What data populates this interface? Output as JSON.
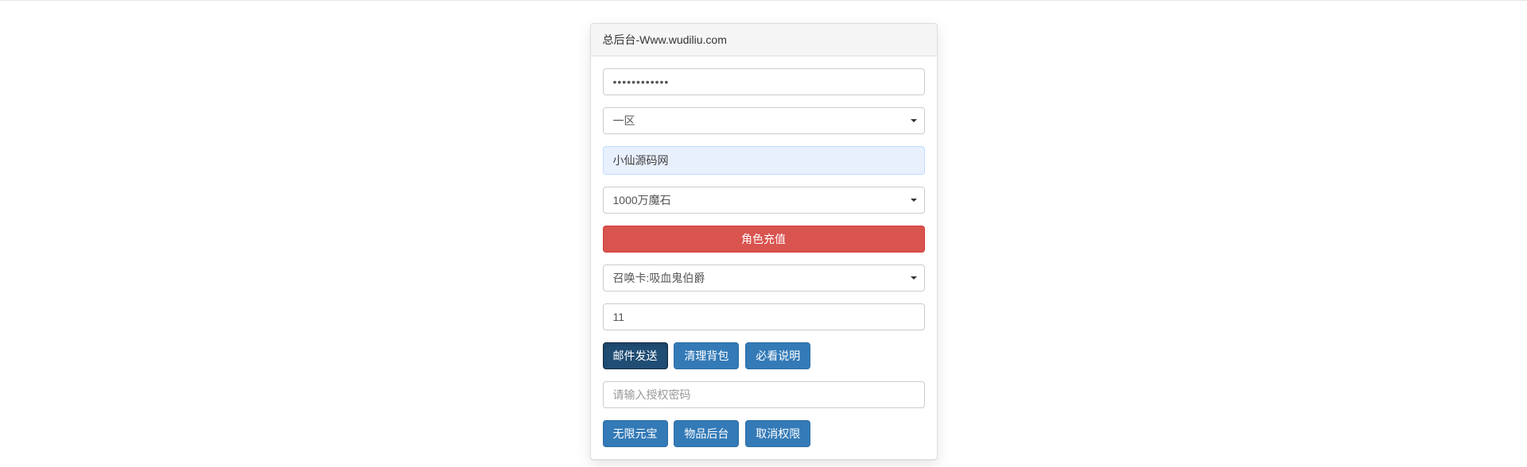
{
  "panel": {
    "title": "总后台-Www.wudiliu.com"
  },
  "password": {
    "value": "••••••••••••"
  },
  "zone_select": {
    "selected": "一区"
  },
  "character_label": "小仙源码网",
  "reward_select": {
    "selected": "1000万魔石"
  },
  "recharge_button": "角色充值",
  "item_select": {
    "selected": "召唤卡:吸血鬼伯爵"
  },
  "quantity": {
    "value": "11"
  },
  "mail_buttons": {
    "send": "邮件发送",
    "clear": "清理背包",
    "help": "必看说明"
  },
  "auth_password": {
    "placeholder": "请输入授权密码"
  },
  "auth_buttons": {
    "unlimited": "无限元宝",
    "items": "物品后台",
    "revoke": "取消权限"
  }
}
